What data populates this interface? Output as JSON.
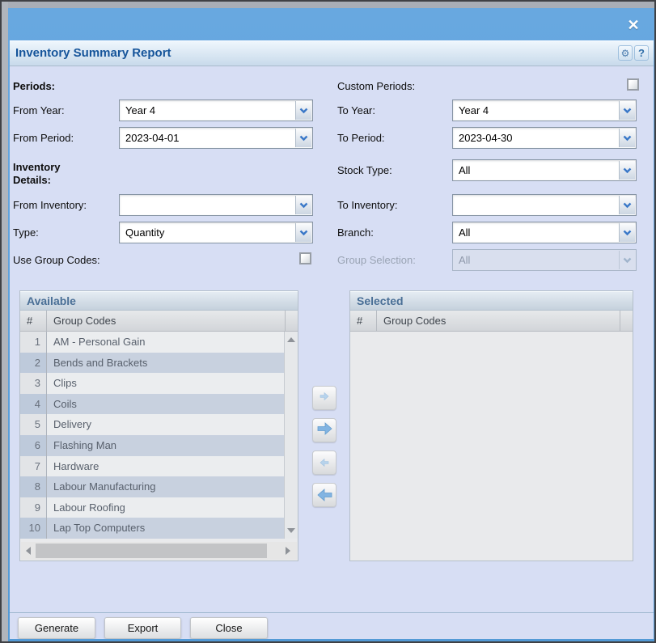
{
  "window": {
    "close_icon": "✕"
  },
  "header": {
    "title": "Inventory Summary Report",
    "gear_icon": "⚙",
    "help_label": "?"
  },
  "form": {
    "periods_label": "Periods:",
    "custom_periods_label": "Custom Periods:",
    "from_year": {
      "label": "From Year:",
      "value": "Year 4"
    },
    "to_year": {
      "label": "To Year:",
      "value": "Year 4"
    },
    "from_period": {
      "label": "From Period:",
      "value": "2023-04-01"
    },
    "to_period": {
      "label": "To Period:",
      "value": "2023-04-30"
    },
    "inventory_details_label": "Inventory Details:",
    "stock_type": {
      "label": "Stock Type:",
      "value": "All"
    },
    "from_inventory": {
      "label": "From Inventory:",
      "value": ""
    },
    "to_inventory": {
      "label": "To Inventory:",
      "value": ""
    },
    "type": {
      "label": "Type:",
      "value": "Quantity"
    },
    "branch": {
      "label": "Branch:",
      "value": "All"
    },
    "use_group_codes_label": "Use Group Codes:",
    "group_selection": {
      "label": "Group Selection:",
      "value": "All",
      "disabled": true
    }
  },
  "available_panel": {
    "title": "Available",
    "columns": [
      "#",
      "Group Codes"
    ],
    "rows": [
      {
        "num": "1",
        "name": "AM - Personal Gain"
      },
      {
        "num": "2",
        "name": "Bends and Brackets"
      },
      {
        "num": "3",
        "name": "Clips"
      },
      {
        "num": "4",
        "name": "Coils"
      },
      {
        "num": "5",
        "name": "Delivery"
      },
      {
        "num": "6",
        "name": "Flashing Man"
      },
      {
        "num": "7",
        "name": "Hardware"
      },
      {
        "num": "8",
        "name": "Labour Manufacturing"
      },
      {
        "num": "9",
        "name": "Labour Roofing"
      },
      {
        "num": "10",
        "name": "Lap Top Computers"
      }
    ]
  },
  "selected_panel": {
    "title": "Selected",
    "columns": [
      "#",
      "Group Codes"
    ],
    "rows": []
  },
  "footer": {
    "generate_label": "Generate",
    "export_label": "Export",
    "close_label": "Close"
  },
  "colors": {
    "titlebar": "#5b9edb",
    "dialog_bg": "#d7def4",
    "title_text": "#15549a"
  }
}
